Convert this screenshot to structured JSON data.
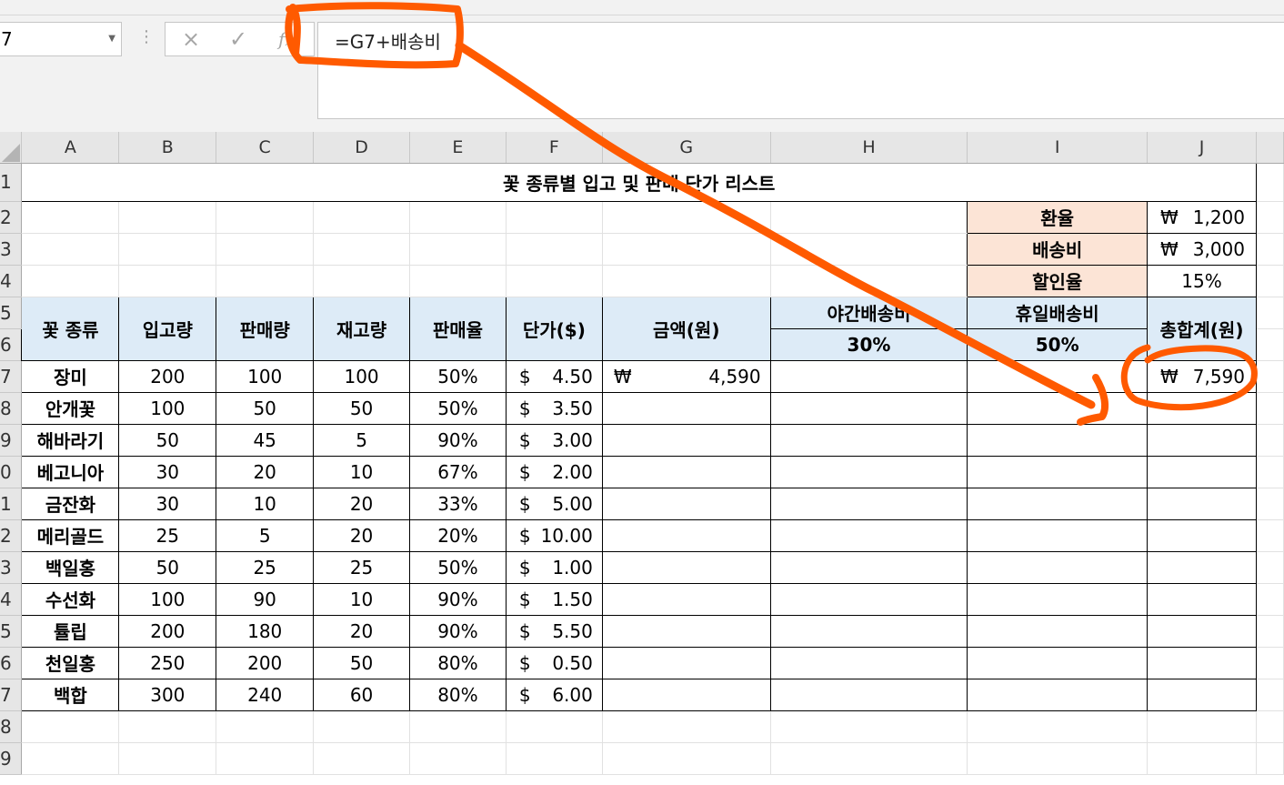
{
  "formula_bar": {
    "name_box": "7",
    "cancel_icon": "×",
    "enter_icon": "✓",
    "fx_icon": "fx",
    "formula": "=G7+배송비"
  },
  "columns": [
    "A",
    "B",
    "C",
    "D",
    "E",
    "F",
    "G",
    "H",
    "I",
    "J"
  ],
  "row_numbers": [
    "1",
    "2",
    "3",
    "4",
    "5",
    "6",
    "7",
    "8",
    "9",
    "0",
    "1",
    "2",
    "3",
    "4",
    "5",
    "6",
    "7",
    "8",
    "9"
  ],
  "title": "꽃 종류별 입고 및 판매 단가 리스트",
  "params": [
    {
      "label": "환율",
      "symbol": "₩",
      "value": "1,200"
    },
    {
      "label": "배송비",
      "symbol": "₩",
      "value": "3,000"
    },
    {
      "label": "할인율",
      "symbol": "",
      "value": "15%"
    }
  ],
  "headers": {
    "flower": "꽃 종류",
    "stock_in": "입고량",
    "sold": "판매량",
    "remaining": "재고량",
    "sales_rate": "판매율",
    "unit_price": "단가($)",
    "amount": "금액(원)",
    "night_fee": "야간배송비",
    "night_rate": "30%",
    "holiday_fee": "휴일배송비",
    "holiday_rate": "50%",
    "total": "총합계(원)"
  },
  "rows": [
    {
      "name": "장미",
      "in": "200",
      "sold": "100",
      "stock": "100",
      "rate": "50%",
      "cur": "$",
      "price": "4.50",
      "amt_sym": "₩",
      "amount": "4,590",
      "tot_sym": "₩",
      "total": "7,590"
    },
    {
      "name": "안개꽃",
      "in": "100",
      "sold": "50",
      "stock": "50",
      "rate": "50%",
      "cur": "$",
      "price": "3.50",
      "amt_sym": "",
      "amount": "",
      "tot_sym": "",
      "total": ""
    },
    {
      "name": "해바라기",
      "in": "50",
      "sold": "45",
      "stock": "5",
      "rate": "90%",
      "cur": "$",
      "price": "3.00",
      "amt_sym": "",
      "amount": "",
      "tot_sym": "",
      "total": ""
    },
    {
      "name": "베고니아",
      "in": "30",
      "sold": "20",
      "stock": "10",
      "rate": "67%",
      "cur": "$",
      "price": "2.00",
      "amt_sym": "",
      "amount": "",
      "tot_sym": "",
      "total": ""
    },
    {
      "name": "금잔화",
      "in": "30",
      "sold": "10",
      "stock": "20",
      "rate": "33%",
      "cur": "$",
      "price": "5.00",
      "amt_sym": "",
      "amount": "",
      "tot_sym": "",
      "total": ""
    },
    {
      "name": "메리골드",
      "in": "25",
      "sold": "5",
      "stock": "20",
      "rate": "20%",
      "cur": "$",
      "price": "10.00",
      "amt_sym": "",
      "amount": "",
      "tot_sym": "",
      "total": ""
    },
    {
      "name": "백일홍",
      "in": "50",
      "sold": "25",
      "stock": "25",
      "rate": "50%",
      "cur": "$",
      "price": "1.00",
      "amt_sym": "",
      "amount": "",
      "tot_sym": "",
      "total": ""
    },
    {
      "name": "수선화",
      "in": "100",
      "sold": "90",
      "stock": "10",
      "rate": "90%",
      "cur": "$",
      "price": "1.50",
      "amt_sym": "",
      "amount": "",
      "tot_sym": "",
      "total": ""
    },
    {
      "name": "튤립",
      "in": "200",
      "sold": "180",
      "stock": "20",
      "rate": "90%",
      "cur": "$",
      "price": "5.50",
      "amt_sym": "",
      "amount": "",
      "tot_sym": "",
      "total": ""
    },
    {
      "name": "천일홍",
      "in": "250",
      "sold": "200",
      "stock": "50",
      "rate": "80%",
      "cur": "$",
      "price": "0.50",
      "amt_sym": "",
      "amount": "",
      "tot_sym": "",
      "total": ""
    },
    {
      "name": "백합",
      "in": "300",
      "sold": "240",
      "stock": "60",
      "rate": "80%",
      "cur": "$",
      "price": "6.00",
      "amt_sym": "",
      "amount": "",
      "tot_sym": "",
      "total": ""
    }
  ],
  "annotation_color": "#ff5a00"
}
